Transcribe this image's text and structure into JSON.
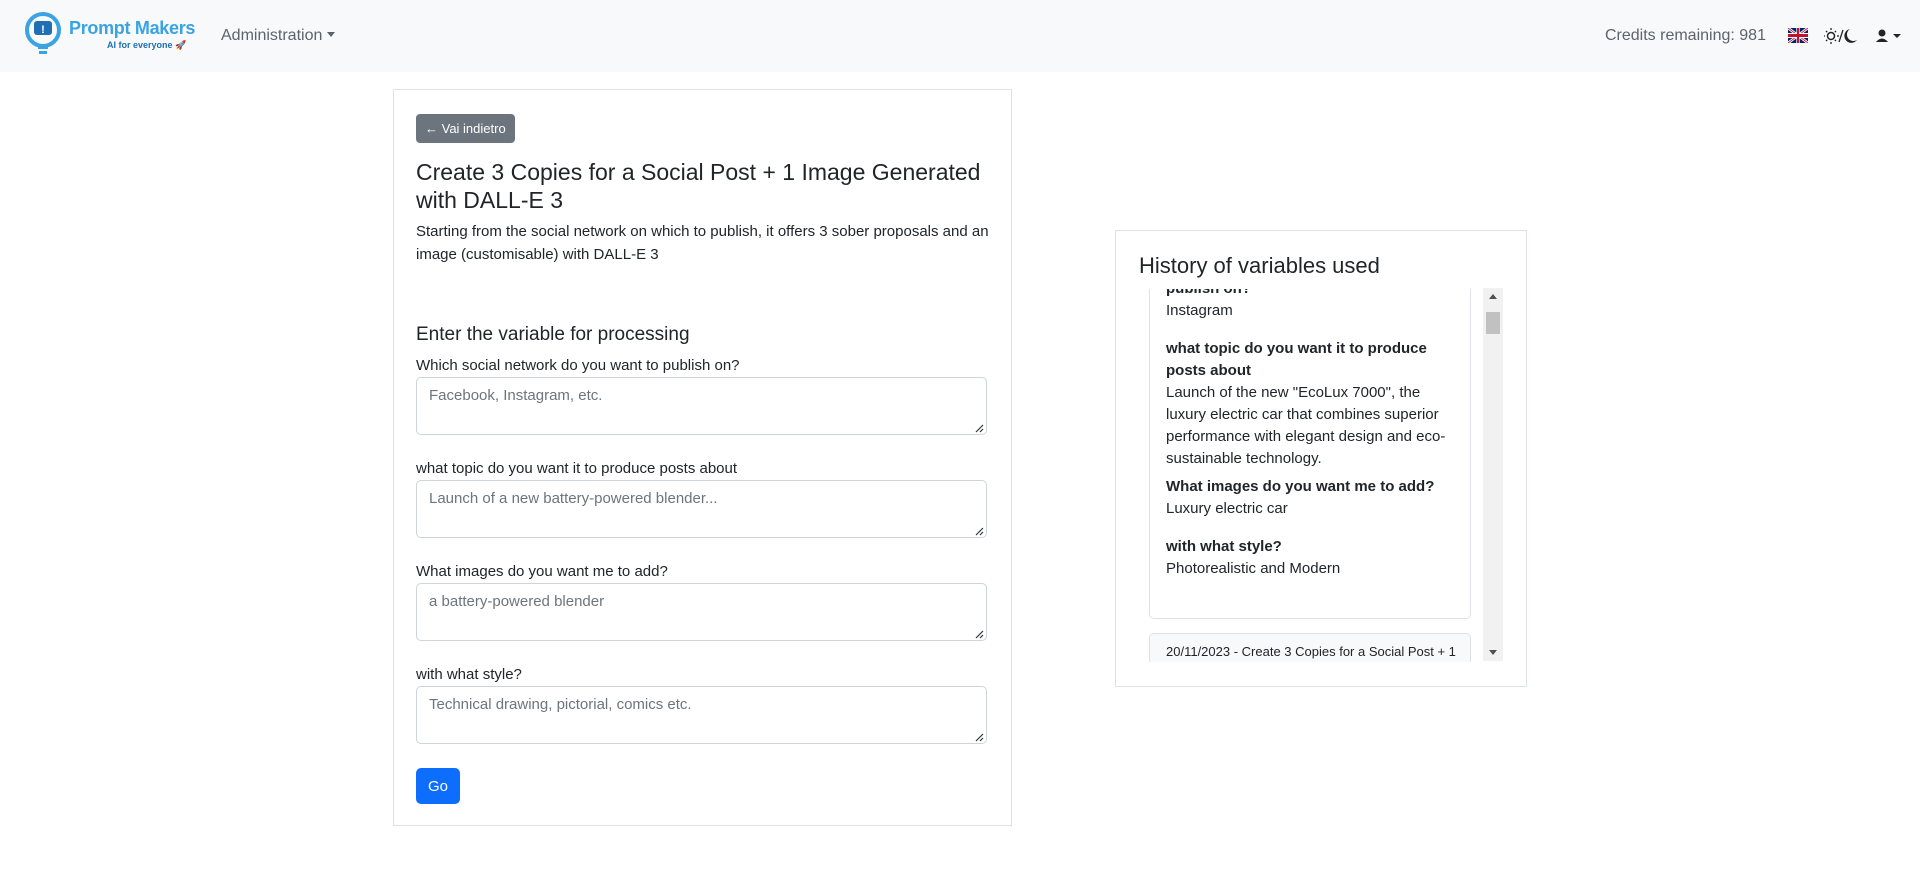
{
  "navbar": {
    "brand_name": "Prompt Makers",
    "brand_tagline": "AI for everyone 🚀",
    "admin_menu": "Administration",
    "credits": "Credits remaining: 981"
  },
  "form": {
    "back_label": "← Vai indietro",
    "title": "Create 3 Copies for a Social Post + 1 Image Generated with DALL-E 3",
    "description": "Starting from the social network on which to publish, it offers 3 sober proposals and an image (customisable) with DALL-E 3",
    "section_title": "Enter the variable for processing",
    "fields": [
      {
        "label": "Which social network do you want to publish on?",
        "placeholder": "Facebook, Instagram, etc."
      },
      {
        "label": "what topic do you want it to produce posts about",
        "placeholder": "Launch of a new battery-powered blender..."
      },
      {
        "label": "What images do you want me to add?",
        "placeholder": "a battery-powered blender"
      },
      {
        "label": "with what style?",
        "placeholder": "Technical drawing, pictorial, comics etc."
      }
    ],
    "go_label": "Go"
  },
  "history": {
    "title": "History of variables used",
    "items": [
      {
        "question": "publish on?",
        "answer": "Instagram"
      },
      {
        "question": "what topic do you want it to produce posts about",
        "answer": "Launch of the new \"EcoLux 7000\", the luxury electric car that combines superior performance with elegant design and eco-sustainable technology."
      },
      {
        "question": "What images do you want me to add?",
        "answer": "Luxury electric car"
      },
      {
        "question": "with what style?",
        "answer": "Photorealistic and Modern"
      }
    ],
    "next_entry": "20/11/2023 - Create 3 Copies for a Social Post + 1"
  },
  "icons": {
    "flag": "uk-flag-icon",
    "theme": "sun-moon-icon",
    "user": "user-icon"
  },
  "colors": {
    "primary": "#0d6efd",
    "secondary": "#6c757d",
    "brand": "#3aa3e3"
  }
}
